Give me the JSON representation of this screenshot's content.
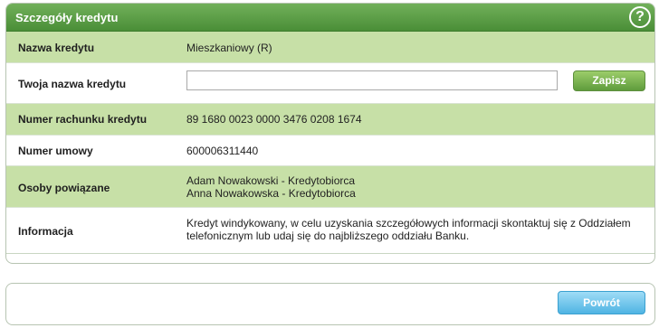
{
  "panel": {
    "title": "Szczegóły kredytu",
    "help_symbol": "?"
  },
  "rows": {
    "credit_name": {
      "label": "Nazwa kredytu",
      "value": "Mieszkaniowy (R)"
    },
    "your_credit_name": {
      "label": "Twoja nazwa kredytu",
      "input_value": "",
      "save_label": "Zapisz"
    },
    "account_number": {
      "label": "Numer rachunku kredytu",
      "value": "89 1680 0023 0000 3476 0208 1674"
    },
    "contract_number": {
      "label": "Numer umowy",
      "value": "600006311440"
    },
    "related_persons": {
      "label": "Osoby powiązane",
      "values": [
        "Adam Nowakowski - Kredytobiorca",
        "Anna Nowakowska - Kredytobiorca"
      ]
    },
    "information": {
      "label": "Informacja",
      "lines": [
        "Kredyt windykowany, w celu uzyskania szczegółowych informacji skontaktuj się z Oddziałem",
        "telefonicznym lub udaj się do najbliższego oddziału Banku."
      ]
    }
  },
  "footer": {
    "back_label": "Powrót"
  },
  "colors": {
    "header_green": "#4a8e37",
    "row_green": "#c7e0a7",
    "save_button": "#5f9c3c",
    "back_button": "#4fb4e3"
  },
  "icons": {
    "help": "help-question-icon"
  }
}
